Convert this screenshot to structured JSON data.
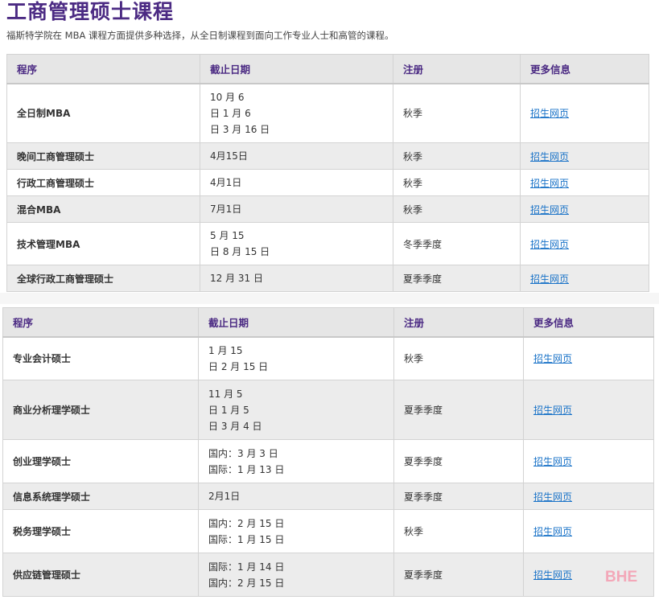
{
  "title": "工商管理硕士课程",
  "subtitle": "福斯特学院在 MBA 课程方面提供多种选择，从全日制课程到面向工作专业人士和高管的课程。",
  "headers": [
    "程序",
    "截止日期",
    "注册",
    "更多信息"
  ],
  "table1": {
    "rows": [
      {
        "name": "全日制MBA",
        "dates": [
          "10 月 6",
          "日 1 月 6",
          "日 3 月 16 日"
        ],
        "term": "秋季",
        "link": "招生网页"
      },
      {
        "name": "晚间工商管理硕士",
        "dates": [
          "4月15日"
        ],
        "term": "秋季",
        "link": "招生网页"
      },
      {
        "name": "行政工商管理硕士",
        "dates": [
          "4月1日"
        ],
        "term": "秋季",
        "link": "招生网页"
      },
      {
        "name": "混合MBA",
        "dates": [
          "7月1日"
        ],
        "term": "秋季",
        "link": "招生网页"
      },
      {
        "name": "技术管理MBA",
        "dates": [
          "5 月 15",
          "日 8 月 15 日"
        ],
        "term": "冬季季度",
        "link": "招生网页"
      },
      {
        "name": "全球行政工商管理硕士",
        "dates": [
          "12 月 31 日"
        ],
        "term": "夏季季度",
        "link": "招生网页"
      }
    ]
  },
  "table2": {
    "rows": [
      {
        "name": "专业会计硕士",
        "dates": [
          "1 月 15",
          "日 2 月 15 日"
        ],
        "term": "秋季",
        "link": "招生网页"
      },
      {
        "name": "商业分析理学硕士",
        "dates": [
          "11 月 5",
          "日 1 月 5",
          "日 3 月 4 日"
        ],
        "term": "夏季季度",
        "link": "招生网页"
      },
      {
        "name": "创业理学硕士",
        "dates": [
          "国内：3 月 3 日",
          "国际：1 月 13 日"
        ],
        "term": "夏季季度",
        "link": "招生网页"
      },
      {
        "name": "信息系统理学硕士",
        "dates": [
          "2月1日"
        ],
        "term": "夏季季度",
        "link": "招生网页"
      },
      {
        "name": "税务理学硕士",
        "dates": [
          "国内：2 月 15 日",
          "国际：1 月 15 日"
        ],
        "term": "秋季",
        "link": "招生网页"
      },
      {
        "name": "供应链管理硕士",
        "dates": [
          "国际：1 月 14 日",
          "国内：2 月 15 日"
        ],
        "term": "夏季季度",
        "link": "招生网页"
      }
    ]
  },
  "watermark": "BHE",
  "colors": {
    "title": "#4b2a83",
    "header_bg": "#e6e6e6",
    "row_shade": "#ececec",
    "link": "#1a73c8"
  }
}
